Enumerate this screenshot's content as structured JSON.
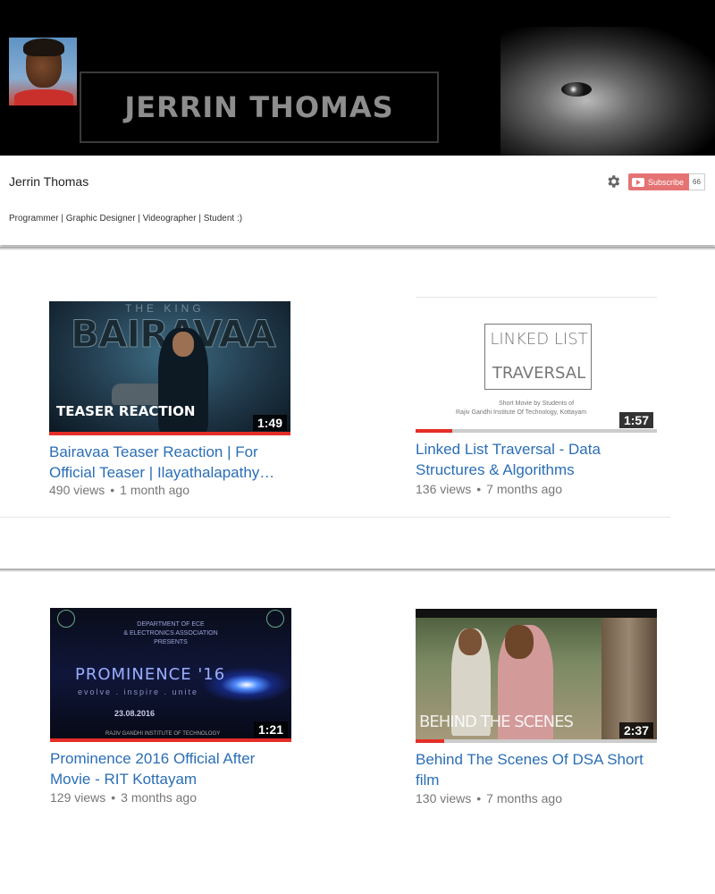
{
  "banner": {
    "title": "JERRIN THOMAS"
  },
  "channel": {
    "name": "Jerrin Thomas",
    "description": "Programmer | Graphic Designer | Videographer | Student :)",
    "subscribe_label": "Subscribe",
    "subscriber_count": "66"
  },
  "videos": [
    {
      "title": "Bairavaa Teaser Reaction | For Official Teaser | Ilayathalapathy…",
      "views": "490 views",
      "age": "1 month ago",
      "duration": "1:49",
      "watched_fraction": 1.0,
      "thumb_text": {
        "small": "THE KING",
        "big": "BAIRAVAA",
        "caption": "TEASER REACTION"
      }
    },
    {
      "title": "Linked List Traversal - Data Structures & Algorithms",
      "views": "136 views",
      "age": "7 months ago",
      "duration": "1:57",
      "watched_fraction": 0.15,
      "thumb_text": {
        "line1": "LINKED LIST",
        "line2": "TRAVERSAL",
        "cap1": "Short Movie by Students of",
        "cap2": "Rajiv Gandhi Institute Of Technology, Kottayam"
      }
    },
    {
      "title": "Prominence 2016 Official After Movie - RIT Kottayam",
      "views": "129 views",
      "age": "3 months ago",
      "duration": "1:21",
      "watched_fraction": 1.0,
      "thumb_text": {
        "dept1": "DEPARTMENT OF ECE",
        "dept2": "& ELECTRONICS ASSOCIATION",
        "dept3": "PRESENTS",
        "name": "PROMINENCE '16",
        "tagline": "evolve . inspire . unite",
        "date": "23.08.2016",
        "inst": "RAJIV GANDHI INSTITUTE OF TECHNOLOGY"
      }
    },
    {
      "title": "Behind The Scenes Of DSA Short film",
      "views": "130 views",
      "age": "7 months ago",
      "duration": "2:37",
      "watched_fraction": 0.12,
      "thumb_text": {
        "caption": "BEHIND THE SCENES"
      }
    }
  ],
  "colors": {
    "link": "#2a6eb5",
    "progress": "#e52d27",
    "subscribe": "#e57373"
  }
}
